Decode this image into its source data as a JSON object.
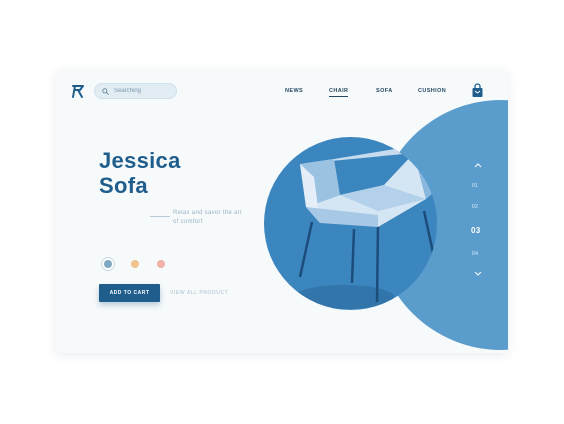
{
  "search": {
    "placeholder": "Searching"
  },
  "nav": {
    "items": [
      {
        "label": "NEWS",
        "active": false
      },
      {
        "label": "CHAIR",
        "active": true
      },
      {
        "label": "SOFA",
        "active": false
      },
      {
        "label": "CUSHION",
        "active": false
      }
    ]
  },
  "hero": {
    "title_line1": "Jessica",
    "title_line2": "Sofa",
    "tagline": "Relax and savor the art of comfort"
  },
  "swatches": {
    "colors": [
      "#7fa9c3",
      "#f1c48e",
      "#f0b2a6"
    ],
    "selected_index": 0
  },
  "actions": {
    "add_to_cart": "ADD TO CART",
    "view_all": "VIEW ALL PRODUCT"
  },
  "slider": {
    "numbers": [
      "01",
      "02",
      "03",
      "04"
    ],
    "active_index": 2
  },
  "colors": {
    "accent": "#1f5d8c",
    "circle": "#5a9dcc",
    "product_circle": "#3c86c0",
    "background": "#f7fafb"
  },
  "icons": {
    "logo": "brand-logo-icon",
    "search": "search-icon",
    "cart": "shopping-bag-icon",
    "slider_up": "chevron-up-icon",
    "slider_down": "chevron-down-icon"
  }
}
